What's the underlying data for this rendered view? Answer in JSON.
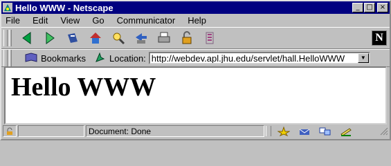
{
  "window": {
    "title": "Hello WWW - Netscape",
    "controls": {
      "minimize": "_",
      "maximize": "□",
      "close": "×"
    }
  },
  "menu": [
    "File",
    "Edit",
    "View",
    "Go",
    "Communicator",
    "Help"
  ],
  "toolbar": {
    "buttons": [
      "back-icon",
      "forward-icon",
      "reload-icon",
      "home-icon",
      "search-icon",
      "guide-icon",
      "print-icon",
      "security-icon",
      "stop-icon"
    ],
    "logo": "N"
  },
  "locationbar": {
    "bookmarks_label": "Bookmarks",
    "location_label": "Location:",
    "url": "http://webdev.apl.jhu.edu/servlet/hall.HelloWWW"
  },
  "content": {
    "heading": "Hello WWW"
  },
  "status": {
    "text": "Document: Done"
  },
  "colors": {
    "titlebar": "#000080",
    "chrome": "#c0c0c0"
  }
}
